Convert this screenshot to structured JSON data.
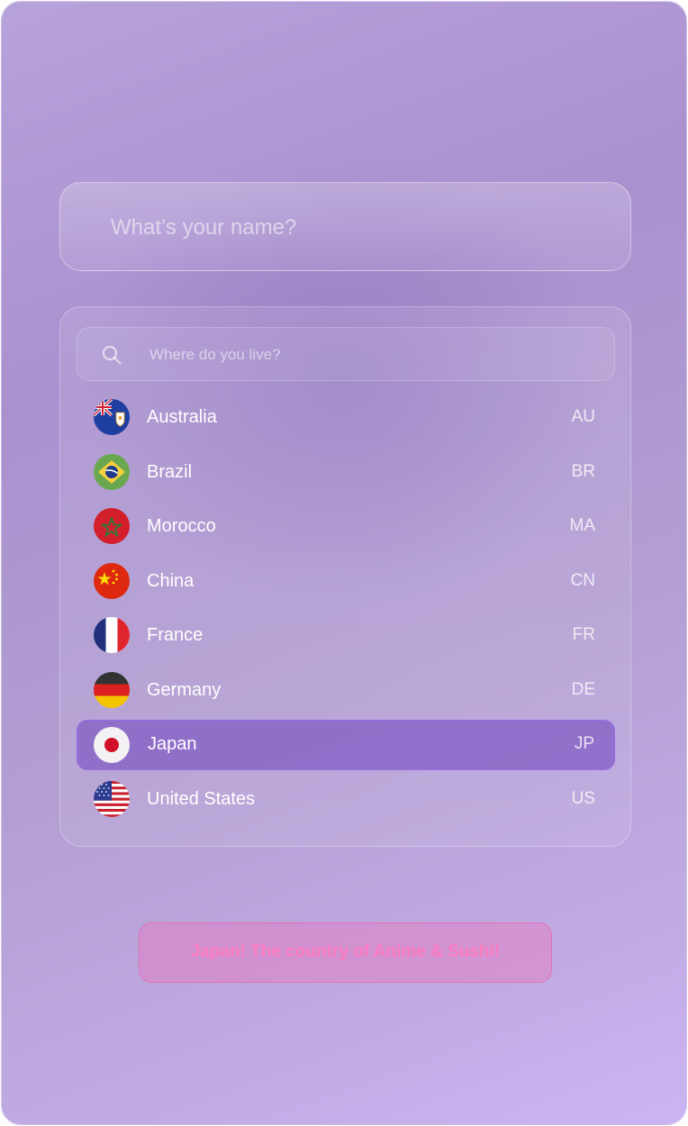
{
  "form": {
    "name_placeholder": "What’s your name?",
    "search_placeholder": "Where do you live?"
  },
  "countries": [
    {
      "name": "Australia",
      "code": "AU",
      "flag_icon": "australia-flag-icon"
    },
    {
      "name": "Brazil",
      "code": "BR",
      "flag_icon": "brazil-flag-icon"
    },
    {
      "name": "Morocco",
      "code": "MA",
      "flag_icon": "morocco-flag-icon"
    },
    {
      "name": "China",
      "code": "CN",
      "flag_icon": "china-flag-icon"
    },
    {
      "name": "France",
      "code": "FR",
      "flag_icon": "france-flag-icon"
    },
    {
      "name": "Germany",
      "code": "DE",
      "flag_icon": "germany-flag-icon"
    },
    {
      "name": "Japan",
      "code": "JP",
      "flag_icon": "japan-flag-icon",
      "selected": true
    },
    {
      "name": "United States",
      "code": "US",
      "flag_icon": "usa-flag-icon"
    }
  ],
  "selected_country": "Japan",
  "message": "Japan! The country of Anime & Sushi!",
  "colors": {
    "selected_row": "#8a64c4",
    "message_text": "#f27ac0",
    "message_border": "#e864af"
  }
}
